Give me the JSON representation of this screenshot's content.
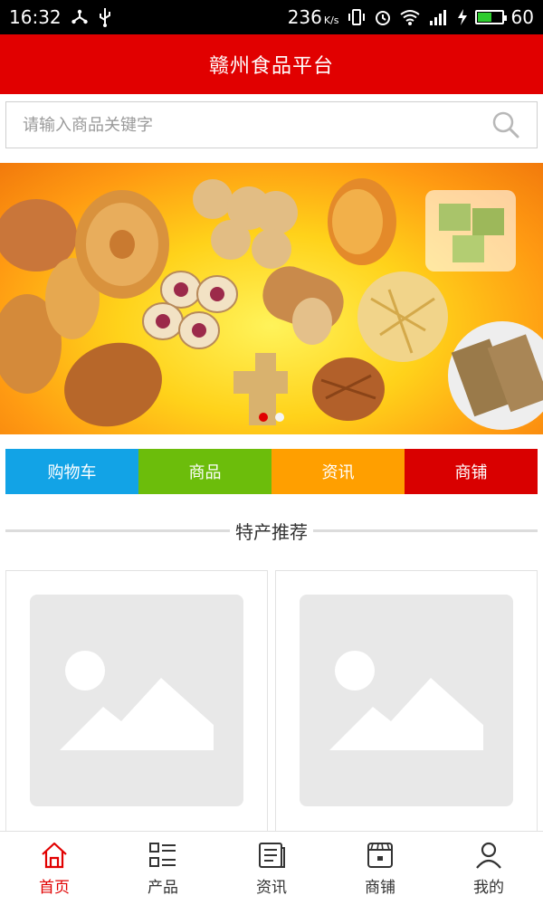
{
  "status_bar": {
    "time": "16:32",
    "speed": "236",
    "speed_unit": "K/s",
    "battery": "60",
    "battery_level": 0.6
  },
  "header": {
    "title": "赣州食品平台"
  },
  "search": {
    "placeholder": "请输入商品关键字",
    "icon": "search-icon"
  },
  "banner": {
    "slide_count": 2,
    "active_index": 0
  },
  "quick_nav": [
    {
      "label": "购物车",
      "color": "#12a3e6"
    },
    {
      "label": "商品",
      "color": "#6cbd0b"
    },
    {
      "label": "资讯",
      "color": "#ff9f00"
    },
    {
      "label": "商铺",
      "color": "#d90000"
    }
  ],
  "section": {
    "title": "特产推荐"
  },
  "products": [
    {
      "image": "image-placeholder-icon"
    },
    {
      "image": "image-placeholder-icon"
    }
  ],
  "bottom_nav": [
    {
      "label": "首页",
      "icon": "home-icon",
      "active": true
    },
    {
      "label": "产品",
      "icon": "grid-list-icon",
      "active": false
    },
    {
      "label": "资讯",
      "icon": "news-icon",
      "active": false
    },
    {
      "label": "商铺",
      "icon": "shop-icon",
      "active": false
    },
    {
      "label": "我的",
      "icon": "user-icon",
      "active": false
    }
  ],
  "colors": {
    "brand": "#e10000",
    "accent_active": "#e10000"
  }
}
